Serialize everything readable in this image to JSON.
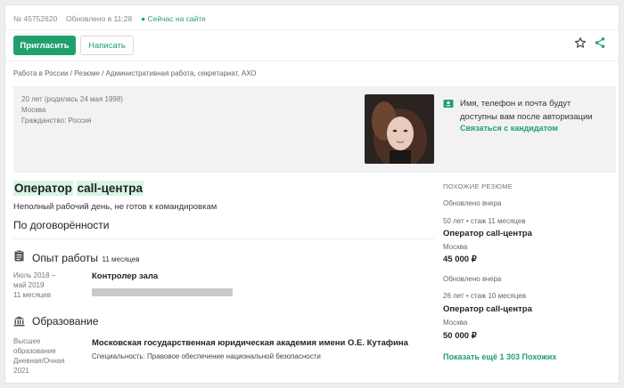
{
  "header": {
    "resume_id": "№ 45752620",
    "updated": "Обновлено в 11:28",
    "online": "Сейчас на сайте"
  },
  "actions": {
    "invite": "Пригласить",
    "write": "Написать"
  },
  "breadcrumb": "Работа в России / Резюме / Административная работа, секретариат, АХО",
  "profile": {
    "age": "20 лет (родилась 24 мая 1998)",
    "city": "Москва",
    "citizenship": "Гражданство: Россия"
  },
  "auth": {
    "text_line1": "Имя, телефон и почта будут",
    "text_line2": "доступны вам после авторизации",
    "link": "Связаться с кандидатом"
  },
  "resume": {
    "title_part1": "Оператор",
    "title_part2": "call-центра",
    "schedule": "Неполный рабочий день, не готов к командировкам",
    "salary": "По договорённости"
  },
  "experience": {
    "heading": "Опыт работы",
    "total": "11 месяцев",
    "items": [
      {
        "period_line1": "Июль 2018 –",
        "period_line2": "май 2019",
        "duration": "11 месяцев",
        "position": "Контролер зала"
      }
    ]
  },
  "education": {
    "heading": "Образование",
    "level_line1": "Высшее",
    "level_line2": "образование",
    "form": "Дневная/Очная",
    "year": "2021",
    "institution": "Московская государственная юридическая академия имени О.Е. Кутафина",
    "specialty": "Специальность: Правовое обеспечение национальной безопасности"
  },
  "similar": {
    "heading": "ПОХОЖИЕ РЕЗЮМЕ",
    "items": [
      {
        "updated": "Обновлено вчера",
        "meta": "50 лет • стаж 11 месяцев",
        "title": "Оператор call-центра",
        "city": "Москва",
        "salary": "45 000 ₽"
      },
      {
        "updated": "Обновлено вчера",
        "meta": "26 лет • стаж 10 месяцев",
        "title": "Оператор call-центра",
        "city": "Москва",
        "salary": "50 000 ₽"
      }
    ],
    "more": "Показать ещё 1 303 Похожих"
  },
  "colors": {
    "accent": "#22a06b",
    "highlight": "#d6f5e3"
  }
}
